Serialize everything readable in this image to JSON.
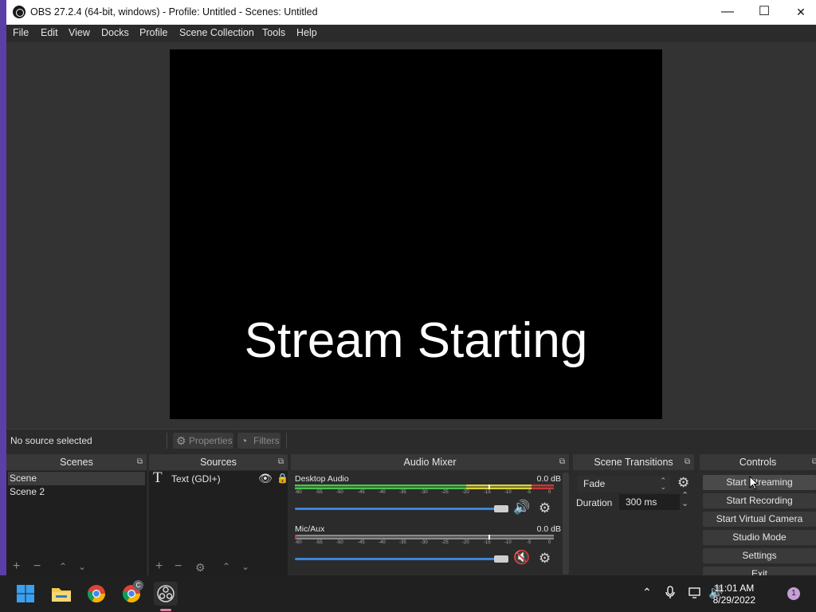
{
  "window": {
    "title": "OBS 27.2.4 (64-bit, windows) - Profile: Untitled - Scenes: Untitled",
    "minimize": "—",
    "maximize": "☐",
    "close": "✕"
  },
  "menu": {
    "items": [
      "File",
      "Edit",
      "View",
      "Docks",
      "Profile",
      "Scene Collection",
      "Tools",
      "Help"
    ]
  },
  "preview": {
    "text": "Stream Starting"
  },
  "source_toolbar": {
    "status": "No source selected",
    "properties": "Properties",
    "filters": "Filters"
  },
  "docks": {
    "scenes": {
      "title": "Scenes",
      "items": [
        "Scene",
        "Scene 2"
      ]
    },
    "sources": {
      "title": "Sources",
      "items": [
        {
          "label": "Text (GDI+)",
          "icon": "text-T-icon"
        }
      ]
    },
    "mixer": {
      "title": "Audio Mixer",
      "scale": [
        "-60",
        "-55",
        "-50",
        "-45",
        "-40",
        "-35",
        "-30",
        "-25",
        "-20",
        "-15",
        "-10",
        "-5",
        "0"
      ],
      "channels": [
        {
          "name": "Desktop Audio",
          "db": "0.0 dB",
          "muted": false
        },
        {
          "name": "Mic/Aux",
          "db": "0.0 dB",
          "muted": true
        }
      ]
    },
    "transitions": {
      "title": "Scene Transitions",
      "selected": "Fade",
      "duration_label": "Duration",
      "duration_value": "300 ms"
    },
    "controls": {
      "title": "Controls",
      "buttons": [
        "Start Streaming",
        "Start Recording",
        "Start Virtual Camera",
        "Studio Mode",
        "Settings",
        "Exit"
      ]
    }
  },
  "taskbar": {
    "time": "11:01 AM",
    "date": "8/29/2022",
    "notification_count": "1",
    "chrome_badge": "C"
  },
  "colors": {
    "accent_blue": "#3a86d8",
    "meter_green": "#4cc24c",
    "meter_yellow": "#d8d23a",
    "meter_red": "#c43a3a",
    "muted_red": "#d12b2b"
  }
}
